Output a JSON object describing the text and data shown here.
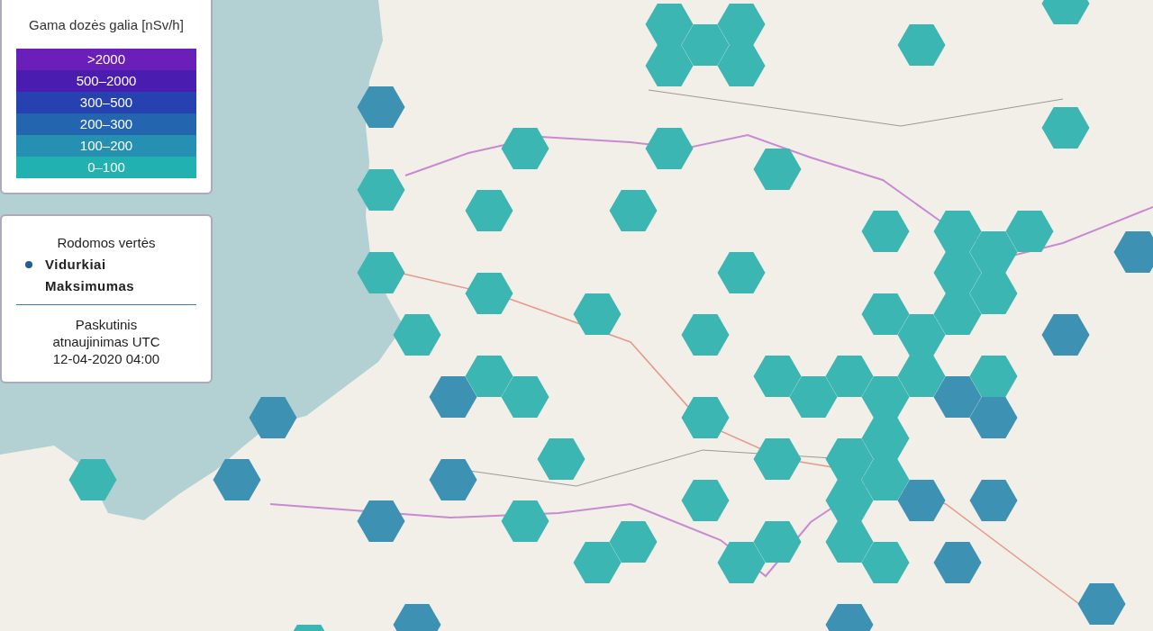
{
  "dose_legend": {
    "title": "Gama dozės galia [nSv/h]",
    "bands": [
      {
        "label": ">2000",
        "color": "#6a1fb8"
      },
      {
        "label": "500–2000",
        "color": "#4a1db0"
      },
      {
        "label": "300–500",
        "color": "#2641b0"
      },
      {
        "label": "200–300",
        "color": "#2465b0"
      },
      {
        "label": "100–200",
        "color": "#2590b2"
      },
      {
        "label": "0–100",
        "color": "#21b1b0"
      }
    ]
  },
  "values_panel": {
    "title": "Rodomos vertės",
    "options": [
      {
        "label": "Vidurkiai",
        "selected": true
      },
      {
        "label": "Maksimumas",
        "selected": false
      }
    ],
    "updated_label": "Paskutinis atnaujinimas UTC",
    "updated_time": "12-04-2020 04:00"
  },
  "hexagons": [
    {
      "color": "#3cb6b2"
    },
    {
      "color": "#3cb6b2"
    },
    {
      "color": "#3cb6b2"
    },
    {
      "color": "#3cb6b2"
    },
    {
      "color": "#3cb6b2"
    },
    {
      "color": "#3cb6b2"
    },
    {
      "color": "#3cb6b2"
    },
    {
      "color": "#3d92b4"
    },
    {
      "color": "#3cb6b2"
    },
    {
      "color": "#3cb6b2"
    },
    {
      "color": "#3cb6b2"
    },
    {
      "color": "#3cb6b2"
    },
    {
      "color": "#3cb6b2"
    },
    {
      "color": "#3cb6b2"
    },
    {
      "color": "#3cb6b2"
    },
    {
      "color": "#3cb6b2"
    },
    {
      "color": "#3cb6b2"
    },
    {
      "color": "#3cb6b2"
    },
    {
      "color": "#3d92b4"
    },
    {
      "color": "#3cb6b2"
    },
    {
      "color": "#3cb6b2"
    },
    {
      "color": "#3cb6b2"
    },
    {
      "color": "#3cb6b2"
    },
    {
      "color": "#3cb6b2"
    },
    {
      "color": "#3cb6b2"
    },
    {
      "color": "#3cb6b2"
    },
    {
      "color": "#3cb6b2"
    },
    {
      "color": "#3cb6b2"
    },
    {
      "color": "#3cb6b2"
    },
    {
      "color": "#3cb6b2"
    },
    {
      "color": "#3cb6b2"
    },
    {
      "color": "#3d92b4"
    },
    {
      "color": "#3cb6b2"
    },
    {
      "color": "#3cb6b2"
    },
    {
      "color": "#3cb6b2"
    },
    {
      "color": "#3cb6b2"
    },
    {
      "color": "#3cb6b2"
    },
    {
      "color": "#3d92b4"
    },
    {
      "color": "#3cb6b2"
    },
    {
      "color": "#3cb6b2"
    },
    {
      "color": "#3cb6b2"
    },
    {
      "color": "#3d92b4"
    },
    {
      "color": "#3d92b4"
    },
    {
      "color": "#3cb6b2"
    },
    {
      "color": "#3d92b4"
    },
    {
      "color": "#3cb6b2"
    },
    {
      "color": "#3cb6b2"
    },
    {
      "color": "#3cb6b2"
    },
    {
      "color": "#3cb6b2"
    },
    {
      "color": "#3cb6b2"
    },
    {
      "color": "#3d92b4"
    },
    {
      "color": "#3d92b4"
    },
    {
      "color": "#3cb6b2"
    },
    {
      "color": "#3cb6b2"
    },
    {
      "color": "#3cb6b2"
    },
    {
      "color": "#3d92b4"
    },
    {
      "color": "#3d92b4"
    },
    {
      "color": "#3d92b4"
    },
    {
      "color": "#3cb6b2"
    },
    {
      "color": "#3cb6b2"
    },
    {
      "color": "#3cb6b2"
    },
    {
      "color": "#3cb6b2"
    },
    {
      "color": "#3cb6b2"
    },
    {
      "color": "#3cb6b2"
    },
    {
      "color": "#3cb6b2"
    },
    {
      "color": "#3d92b4"
    },
    {
      "color": "#3d92b4"
    },
    {
      "color": "#3d92b4"
    },
    {
      "color": "#3d92b4"
    },
    {
      "color": "#3cb6b2"
    }
  ]
}
